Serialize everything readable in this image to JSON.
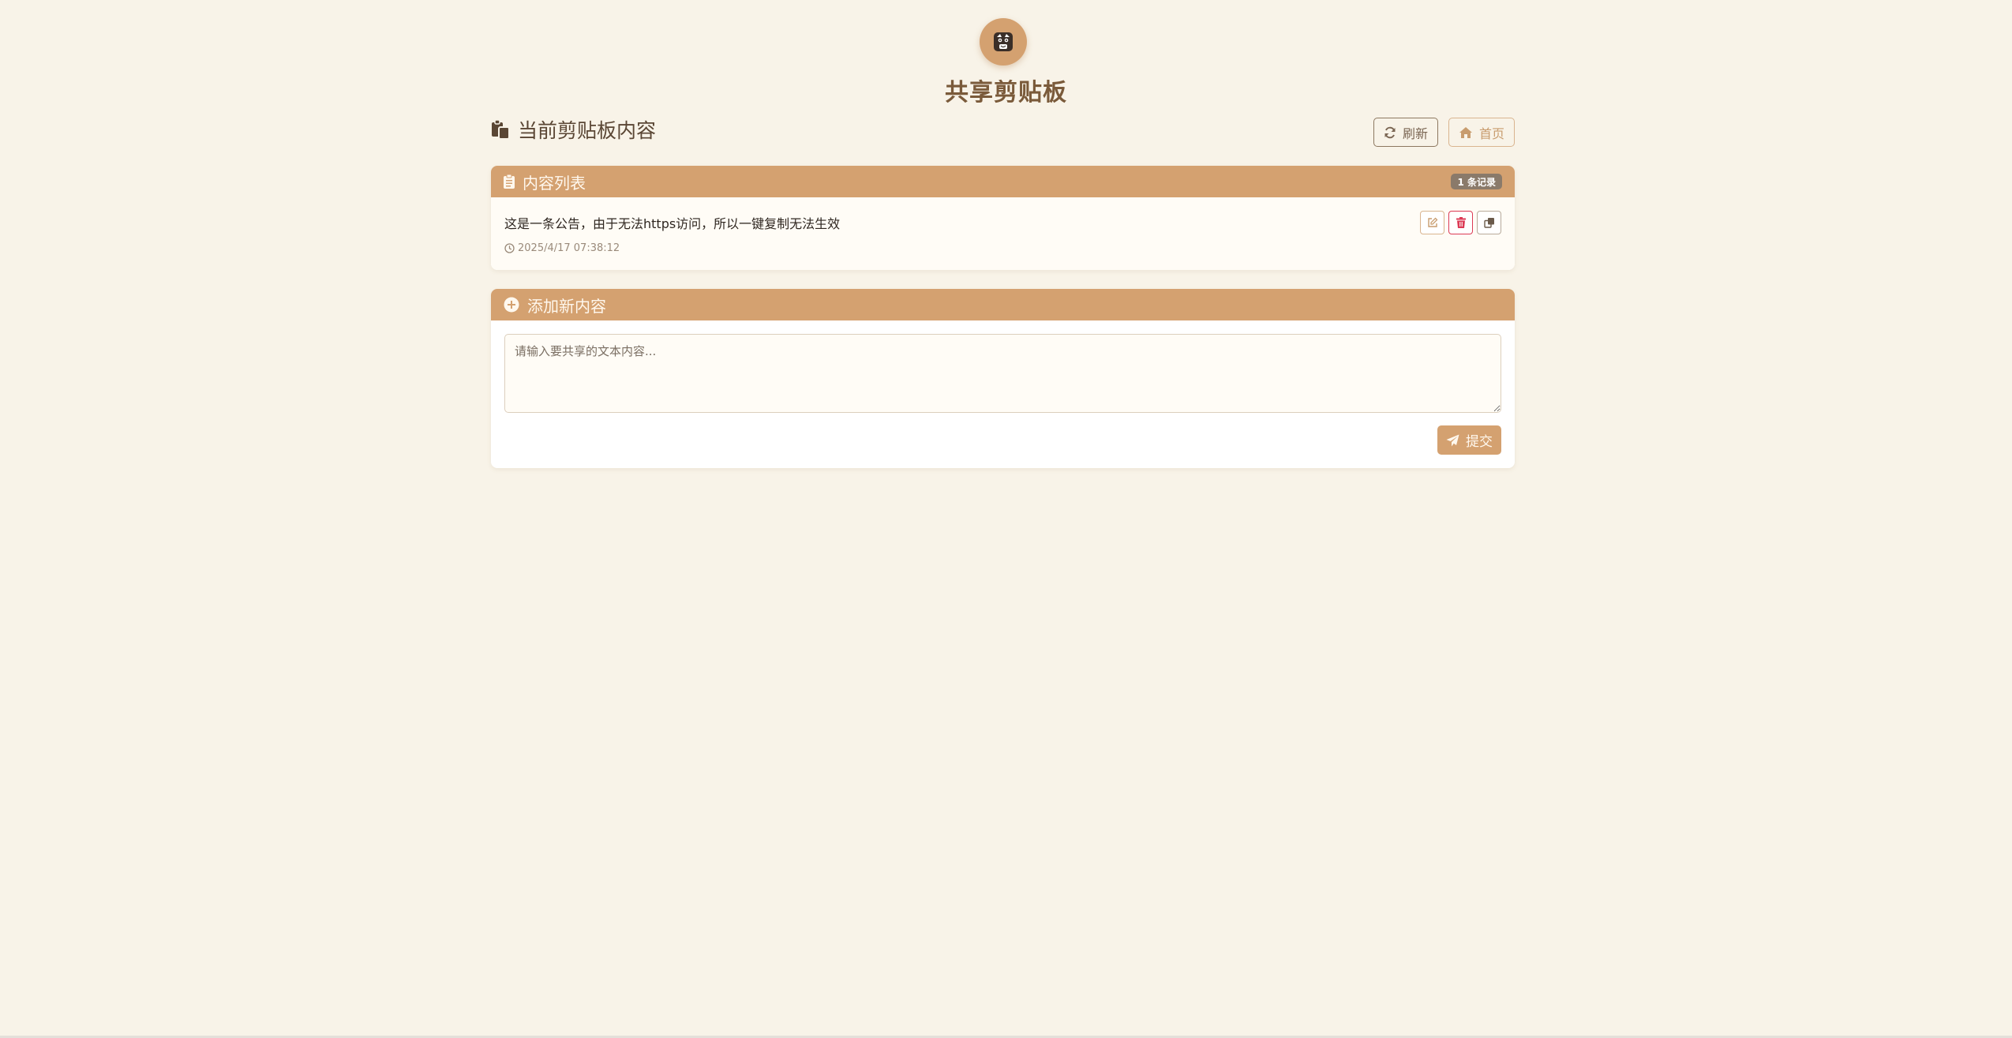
{
  "header": {
    "logo_icon": "cartoon-face-icon",
    "title": "共享剪贴板"
  },
  "page": {
    "heading": "当前剪贴板内容",
    "heading_icon": "paste-icon"
  },
  "toolbar": {
    "refresh_label": "刷新",
    "refresh_icon": "sync-icon",
    "home_label": "首页",
    "home_icon": "home-icon"
  },
  "list": {
    "header_title": "内容列表",
    "header_icon": "clipboard-icon",
    "count_badge": "1 条记录",
    "items": [
      {
        "text": "这是一条公告，由于无法https访问，所以一键复制无法生效",
        "time": "2025/4/17 07:38:12"
      }
    ]
  },
  "add": {
    "header_title": "添加新内容",
    "header_icon": "plus-circle-icon",
    "placeholder": "请输入要共享的文本内容...",
    "submit_label": "提交",
    "submit_icon": "paper-plane-icon"
  },
  "colors": {
    "background": "#f8f3e8",
    "accent": "#d4a170",
    "title": "#7a5a3a",
    "danger": "#dc3a55"
  }
}
